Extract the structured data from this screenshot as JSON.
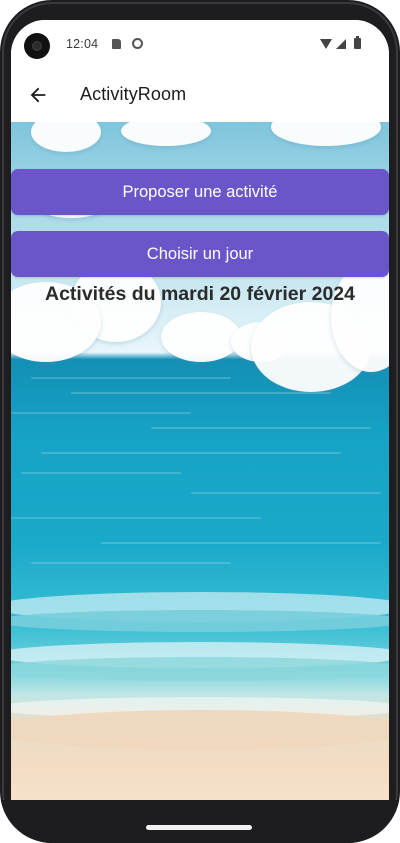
{
  "status_bar": {
    "time": "12:04",
    "icons": [
      "sd-card-icon",
      "sync-icon",
      "wifi-icon",
      "signal-icon",
      "battery-icon"
    ]
  },
  "app_bar": {
    "title": "ActivityRoom",
    "back_icon": "arrow-back-icon"
  },
  "actions": {
    "propose_label": "Proposer une activité",
    "choose_day_label": "Choisir un jour"
  },
  "main": {
    "heading": "Activités du mardi 20 février 2024"
  },
  "colors": {
    "button": "#6a56c9",
    "button_text": "#ffffff",
    "heading_text": "#2b2b2b",
    "sea": "#16a3c6",
    "sand": "#f3dcc3"
  }
}
